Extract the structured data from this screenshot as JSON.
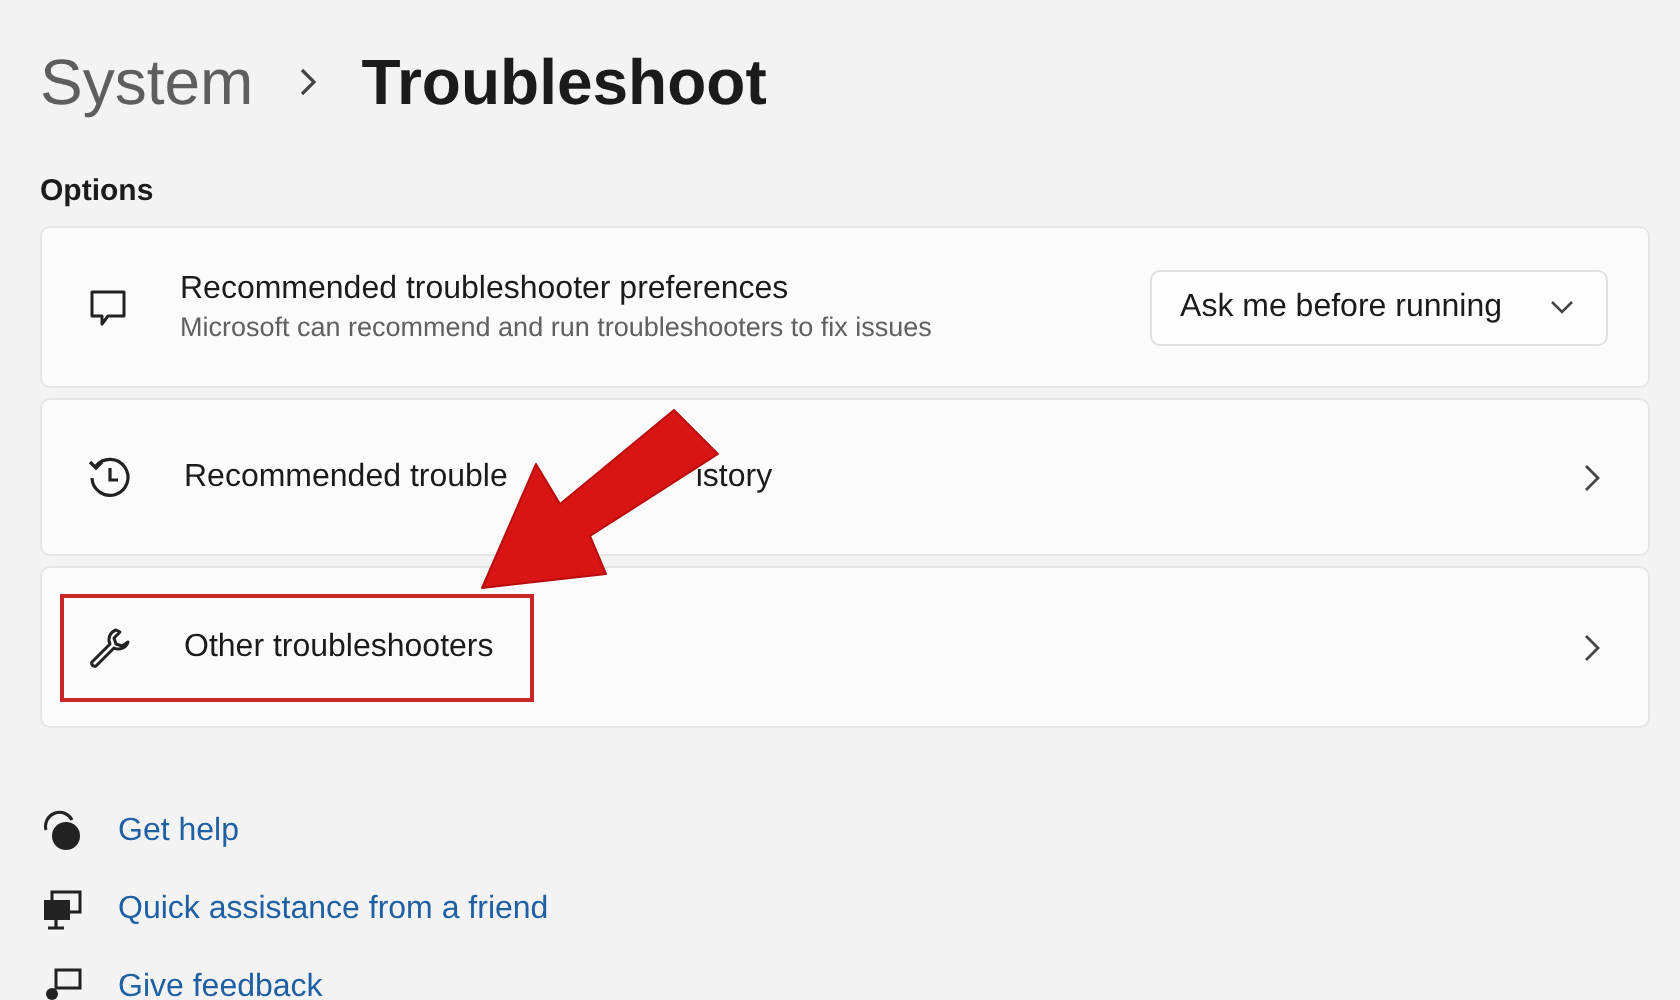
{
  "breadcrumb": [
    {
      "label": "System",
      "current": false
    },
    {
      "label": "Troubleshoot",
      "current": true
    }
  ],
  "section_title": "Options",
  "rows": [
    {
      "kind": "dropdown",
      "title": "Recommended troubleshooter preferences",
      "subtitle": "Microsoft can recommend and run troubleshooters to fix issues",
      "value": "Ask me before running",
      "highlighted": false
    },
    {
      "kind": "link",
      "title_parts": [
        "Recommended trouble",
        "istory"
      ],
      "highlighted": false
    },
    {
      "kind": "link",
      "title": "Other troubleshooters",
      "highlighted": true
    }
  ],
  "arrow": true,
  "links": [
    {
      "label": "Get help"
    },
    {
      "label": "Quick assistance from a friend"
    },
    {
      "label": "Give feedback"
    }
  ]
}
